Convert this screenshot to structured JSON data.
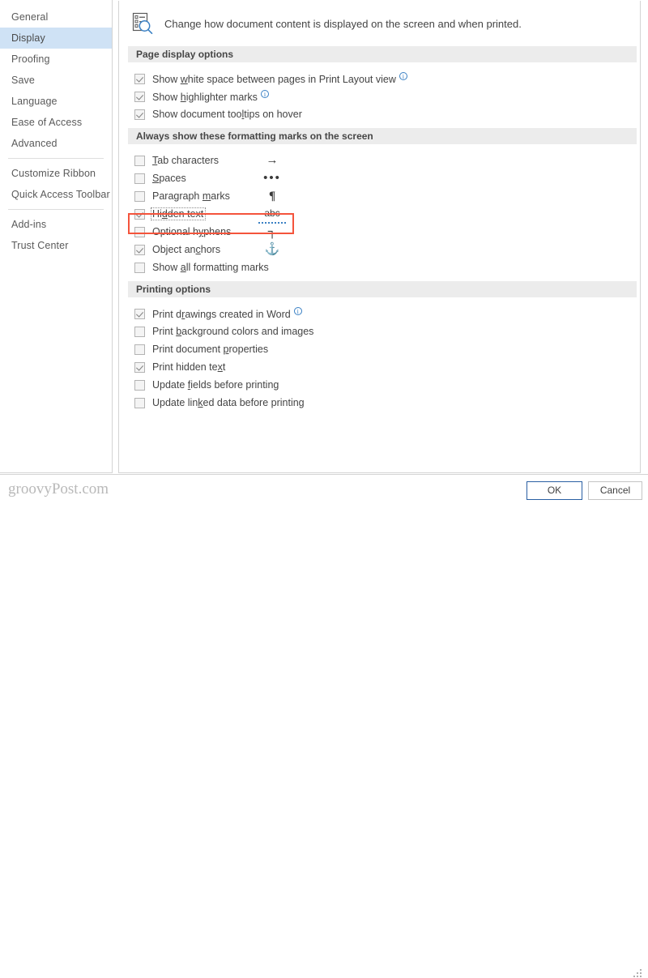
{
  "sidebar": {
    "items": [
      {
        "label": "General",
        "selected": false,
        "sep_after": false
      },
      {
        "label": "Display",
        "selected": true,
        "sep_after": false
      },
      {
        "label": "Proofing",
        "selected": false,
        "sep_after": false
      },
      {
        "label": "Save",
        "selected": false,
        "sep_after": false
      },
      {
        "label": "Language",
        "selected": false,
        "sep_after": false
      },
      {
        "label": "Ease of Access",
        "selected": false,
        "sep_after": false
      },
      {
        "label": "Advanced",
        "selected": false,
        "sep_after": true
      },
      {
        "label": "Customize Ribbon",
        "selected": false,
        "sep_after": false
      },
      {
        "label": "Quick Access Toolbar",
        "selected": false,
        "sep_after": true
      },
      {
        "label": "Add-ins",
        "selected": false,
        "sep_after": false
      },
      {
        "label": "Trust Center",
        "selected": false,
        "sep_after": false
      }
    ]
  },
  "panel": {
    "icon_name": "document-display-search-icon",
    "description": "Change how document content is displayed on the screen and when printed."
  },
  "sections": [
    {
      "title": "Page display options",
      "options": [
        {
          "label_before": "Show ",
          "accel": "w",
          "label_after": "hite space between pages in Print Layout view",
          "checked": true,
          "info": true,
          "glyph": ""
        },
        {
          "label_before": "Show ",
          "accel": "h",
          "label_after": "ighlighter marks",
          "checked": true,
          "info": true,
          "glyph": ""
        },
        {
          "label_before": "Show document too",
          "accel": "l",
          "label_after": "tips on hover",
          "checked": true,
          "info": false,
          "glyph": ""
        }
      ]
    },
    {
      "title": "Always show these formatting marks on the screen",
      "options": [
        {
          "label_before": "",
          "accel": "T",
          "label_after": "ab characters",
          "checked": false,
          "info": false,
          "glyph": "→",
          "glyph_class": "glyph-tab",
          "glyph_name": "tab-arrow-mark"
        },
        {
          "label_before": "",
          "accel": "S",
          "label_after": "paces",
          "checked": false,
          "info": false,
          "glyph": "•••",
          "glyph_class": "glyph-space",
          "glyph_name": "space-dots-mark"
        },
        {
          "label_before": "Paragraph ",
          "accel": "m",
          "label_after": "arks",
          "checked": false,
          "info": false,
          "glyph": "¶",
          "glyph_class": "glyph-para",
          "glyph_name": "pilcrow-mark"
        },
        {
          "label_before": "Hi",
          "accel": "d",
          "label_after": "den text",
          "checked": true,
          "info": false,
          "glyph": "abc",
          "glyph_class": "glyph-abc",
          "glyph_name": "hidden-text-abc-mark",
          "highlighted": true,
          "focused": true
        },
        {
          "label_before": "Optional h",
          "accel": "y",
          "label_after": "phens",
          "checked": false,
          "info": false,
          "glyph": "┐",
          "glyph_class": "glyph-hyph",
          "glyph_name": "optional-hyphen-mark"
        },
        {
          "label_before": "Object an",
          "accel": "c",
          "label_after": "hors",
          "checked": true,
          "info": false,
          "glyph": "⚓",
          "glyph_class": "glyph-anchor",
          "glyph_name": "object-anchor-mark"
        },
        {
          "label_before": "Show ",
          "accel": "a",
          "label_after": "ll formatting marks",
          "checked": false,
          "info": false,
          "glyph": ""
        }
      ]
    },
    {
      "title": "Printing options",
      "options": [
        {
          "label_before": "Print d",
          "accel": "r",
          "label_after": "awings created in Word",
          "checked": true,
          "info": true,
          "glyph": ""
        },
        {
          "label_before": "Print ",
          "accel": "b",
          "label_after": "ackground colors and images",
          "checked": false,
          "info": false,
          "glyph": ""
        },
        {
          "label_before": "Print document ",
          "accel": "p",
          "label_after": "roperties",
          "checked": false,
          "info": false,
          "glyph": ""
        },
        {
          "label_before": "Print hidden te",
          "accel": "x",
          "label_after": "t",
          "checked": true,
          "info": false,
          "glyph": ""
        },
        {
          "label_before": "Update ",
          "accel": "f",
          "label_after": "ields before printing",
          "checked": false,
          "info": false,
          "glyph": ""
        },
        {
          "label_before": "Update lin",
          "accel": "k",
          "label_after": "ed data before printing",
          "checked": false,
          "info": false,
          "glyph": ""
        }
      ]
    }
  ],
  "footer": {
    "watermark": "groovyPost.com",
    "ok_label": "OK",
    "cancel_label": "Cancel"
  },
  "colors": {
    "selection_blue": "#cfe2f5",
    "band_gray": "#ececec",
    "highlight_red": "#f4543c",
    "accent_blue": "#3a80c4",
    "ok_border_blue": "#2a5fa3"
  }
}
